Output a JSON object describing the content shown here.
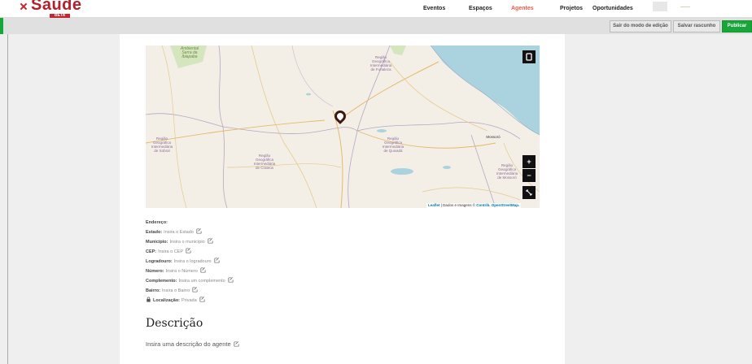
{
  "brand": {
    "name": "Saúde",
    "badge": "BETA",
    "brand_color": "#c6262e"
  },
  "nav": {
    "items": [
      {
        "label": "Eventos",
        "active": false
      },
      {
        "label": "Espaços",
        "active": false
      },
      {
        "label": "Agentes",
        "active": true
      },
      {
        "label": "Projetos",
        "active": false
      },
      {
        "label": "Oportunidades",
        "active": false
      }
    ],
    "active_color": "#ef5a4c"
  },
  "editbar": {
    "exit_label": "Sair do modo de edição",
    "draft_label": "Salvar rascunho",
    "publish_label": "Publicar",
    "publish_color": "#18a53a"
  },
  "map": {
    "labels": [
      "Ambiental\nSerra da\nIbiapaba",
      "Região\nGeográfica\nIntermediária\nde Fortaleza",
      "Região\nGeográfica\nIntermediária\nde Sobral",
      "Região\nGeográfica\nIntermediária\nde Quixadá",
      "Região\nGeográfica\nIntermediária\nde Crateús",
      "Mossoró",
      "Região\nGeográfica\nIntermediária\nde Mossoró"
    ],
    "controls": {
      "layer_icon": "layers-icon",
      "zoom_in": "+",
      "zoom_out": "−",
      "fullscreen_icon": "fullscreen-icon"
    },
    "attribution_leaflet": "Leaflet",
    "attribution_text": " | Dados e Imagens © ",
    "attribution_link": "Contrib. OpenStreetMap."
  },
  "address": {
    "title": "Endereço:",
    "fields": [
      {
        "key": "Estado:",
        "value": "Insira o Estado"
      },
      {
        "key": "Município:",
        "value": "Insira o município"
      },
      {
        "key": "CEP:",
        "value": "Insira o CEP"
      },
      {
        "key": "Logradouro:",
        "value": "Insira o logradouro"
      },
      {
        "key": "Número:",
        "value": "Insira o Número"
      },
      {
        "key": "Complemento:",
        "value": "Insira um complemento"
      },
      {
        "key": "Bairro:",
        "value": "Insira o Bairro"
      },
      {
        "key": "Localização:",
        "value": "Privada"
      }
    ]
  },
  "description": {
    "title": "Descrição",
    "placeholder": "Insira uma descrição do agente"
  }
}
